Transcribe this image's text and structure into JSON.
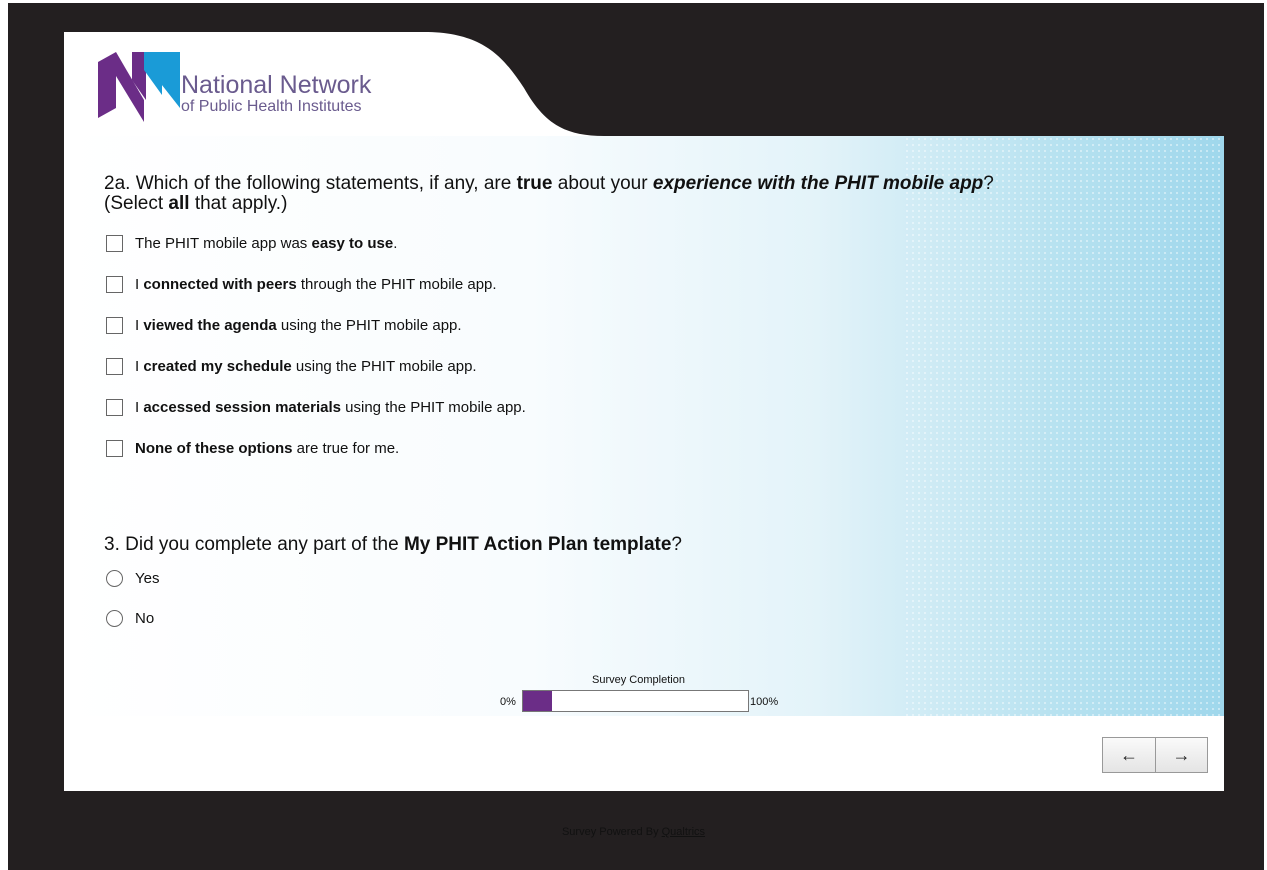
{
  "brand": {
    "name_line1": "National Network",
    "name_line2": "of Public Health Institutes",
    "colors": {
      "purple": "#6b2d87",
      "blue": "#1a9bd7",
      "text": "#6a5b8e"
    }
  },
  "question_2a": {
    "prefix": "2a. Which of the following statements, if any, are ",
    "bold1": "true",
    "mid": " about your ",
    "bolditalic": "experience with the PHIT mobile app",
    "after": "?",
    "line2_prefix": "(Select ",
    "line2_bold": "all",
    "line2_suffix": " that apply.)",
    "options": [
      {
        "pre": "The PHIT mobile app was ",
        "bold": "easy to use",
        "post": "."
      },
      {
        "pre": "I ",
        "bold": "connected with peers",
        "post": " through the PHIT mobile app."
      },
      {
        "pre": "I ",
        "bold": "viewed the agenda",
        "post": " using the PHIT mobile app."
      },
      {
        "pre": "I ",
        "bold": "created my schedule",
        "post": " using the PHIT mobile app."
      },
      {
        "pre": "I ",
        "bold": "accessed session materials",
        "post": " using the PHIT mobile app."
      },
      {
        "pre": "",
        "bold": "None of these options",
        "post": " are true for me."
      }
    ]
  },
  "question_3": {
    "prefix": "3. Did you complete any part of the ",
    "bold": "My PHIT Action Plan template",
    "suffix": "?",
    "options": [
      "Yes",
      "No"
    ]
  },
  "progress": {
    "label": "Survey Completion",
    "min_label": "0%",
    "max_label": "100%",
    "fraction": 0.13
  },
  "nav": {
    "back_label": "←",
    "next_label": "→"
  },
  "footer": {
    "text": "Survey Powered By ",
    "link": "Qualtrics"
  }
}
